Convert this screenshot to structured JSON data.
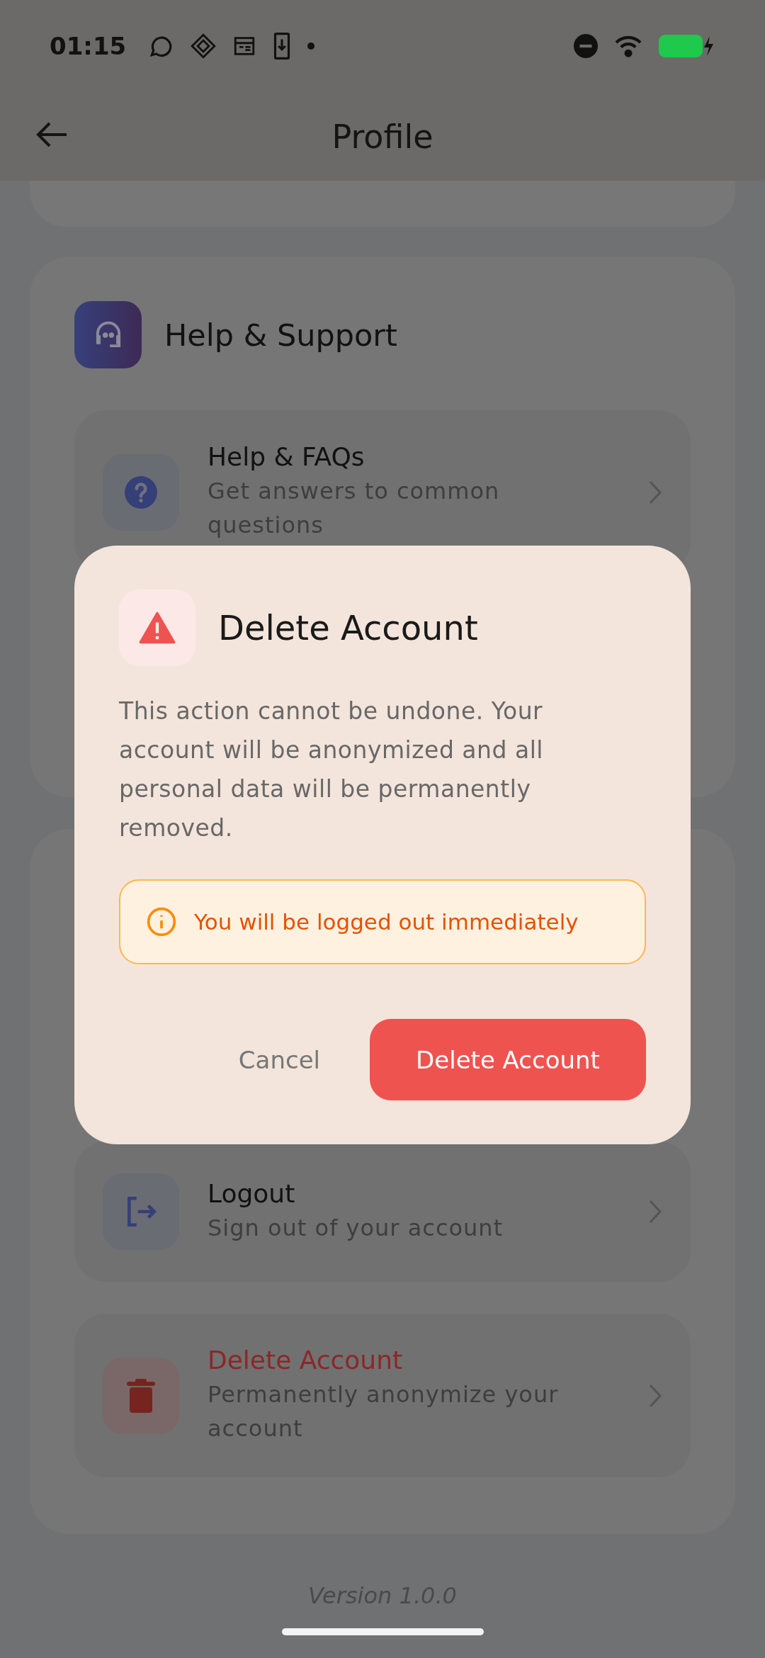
{
  "status_bar": {
    "time": "01:15"
  },
  "header": {
    "title": "Profile"
  },
  "sections": [
    {
      "title": "Help & Support",
      "items": [
        {
          "kind": "help",
          "title": "Help & FAQs",
          "subtitle": "Get answers to common questions"
        }
      ]
    },
    {
      "items": [
        {
          "kind": "logout",
          "title": "Logout",
          "subtitle": "Sign out of your account"
        },
        {
          "kind": "delete",
          "title": "Delete Account",
          "subtitle": "Permanently anonymize your account"
        }
      ]
    }
  ],
  "version": "Version 1.0.0",
  "dialog": {
    "title": "Delete Account",
    "message": "This action cannot be undone. Your account will be anonymized and all personal data will be permanently removed.",
    "warning": "You will be logged out immediately",
    "buttons": [
      {
        "kind": "text",
        "label": "Cancel"
      },
      {
        "kind": "danger",
        "label": "Delete Account"
      }
    ]
  }
}
